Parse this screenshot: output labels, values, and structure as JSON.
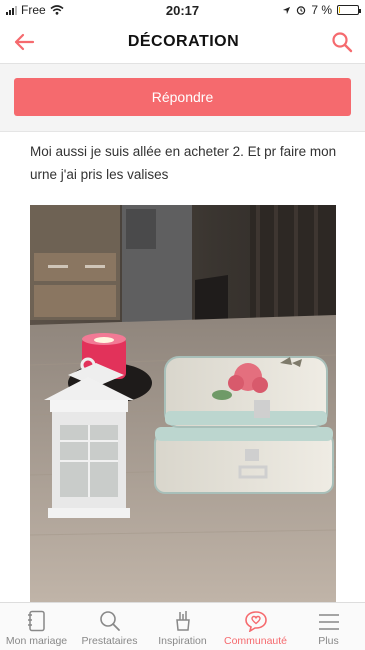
{
  "status": {
    "carrier": "Free",
    "time": "20:17",
    "battery_pct": "7 %",
    "battery_level": 0.07
  },
  "header": {
    "title": "DÉCORATION",
    "back_icon": "arrow-left-icon",
    "search_icon": "search-icon",
    "accent": "#f56a6e"
  },
  "reply": {
    "label": "Répondre",
    "color": "#f56a6e"
  },
  "post": {
    "text": "Moi aussi je suis allée en acheter 2. Et pr faire mon urne j'ai pris les valises"
  },
  "tabs": [
    {
      "label": "Mon mariage",
      "icon": "notebook-icon",
      "active": false
    },
    {
      "label": "Prestataires",
      "icon": "search-icon",
      "active": false
    },
    {
      "label": "Inspiration",
      "icon": "tools-icon",
      "active": false
    },
    {
      "label": "Communauté",
      "icon": "chat-heart-icon",
      "active": true
    },
    {
      "label": "Plus",
      "icon": "menu-icon",
      "active": false
    }
  ]
}
